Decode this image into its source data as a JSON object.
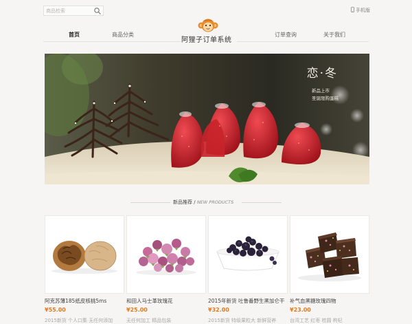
{
  "search": {
    "placeholder": "商品检索",
    "icon": "search-icon"
  },
  "header": {
    "mobile_label": "手机版",
    "logo_title": "阿狸子订单系统",
    "logo_color": "#e88a2a",
    "nav_left": [
      {
        "label": "首页",
        "active": true
      },
      {
        "label": "商品分类",
        "active": false
      }
    ],
    "nav_right": [
      {
        "label": "订单查询",
        "active": false
      },
      {
        "label": "关于我们",
        "active": false
      }
    ]
  },
  "banner": {
    "title": "恋·冬",
    "line1": "新品上市",
    "line2": "圣诞限购蛋糕"
  },
  "section": {
    "title_cn": "新品推荐",
    "title_en": "NEW PRODUCTS"
  },
  "products": [
    {
      "name": "阿克苏薄185纸皮核桃5ms",
      "price": "¥55.00",
      "desc": "2015新货 个人口集 无任何添加",
      "icon": "walnut-image"
    },
    {
      "name": "和田人马士革玫瑰花",
      "price": "¥25.00",
      "desc": "无任何加工 精品包装",
      "icon": "rosebud-image"
    },
    {
      "name": "2015年新货 吐鲁番野生黑加仑干",
      "price": "¥32.00",
      "desc": "2015新货 特级果粒大 新鲜营养",
      "icon": "raisin-image"
    },
    {
      "name": "补气血黑糖玫瑰四物",
      "price": "¥23.00",
      "desc": "台湾工艺 红枣 桂圆 枸杞",
      "icon": "brown-sugar-image"
    }
  ],
  "colors": {
    "accent": "#e88a2a",
    "price": "#e07b1c",
    "background": "#f6f5f3"
  }
}
